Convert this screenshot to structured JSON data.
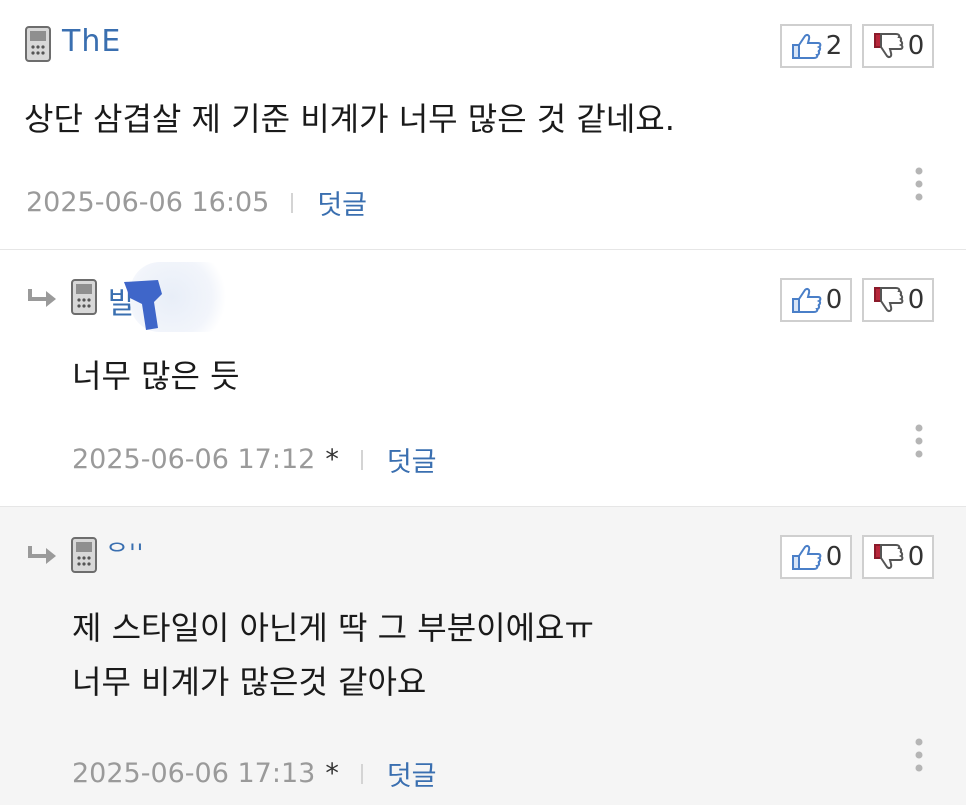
{
  "comments": [
    {
      "nickname": "ThE",
      "likes": "2",
      "dislikes": "0",
      "lines": [
        "상단 삼겹살 제 기준 비계가 너무 많은 것 같네요."
      ],
      "timestamp": "2025-06-06 16:05",
      "reply_label": "덧글",
      "icons": [
        "phone-icon",
        "thumbs-up-icon",
        "thumbs-down-icon",
        "more-vertical-icon"
      ]
    },
    {
      "nickname": "뱔",
      "likes": "0",
      "dislikes": "0",
      "lines": [
        "너무 많은 듯"
      ],
      "timestamp": "2025-06-06 17:12",
      "edited_mark": "*",
      "reply_label": "덧글",
      "icons": [
        "reply-arrow-icon",
        "phone-icon",
        "thumbs-up-icon",
        "thumbs-down-icon",
        "more-vertical-icon"
      ]
    },
    {
      "nickname": "ᄋ''",
      "likes": "0",
      "dislikes": "0",
      "lines": [
        "제 스타일이 아닌게 딱 그 부분이에요ㅠ",
        "너무 비계가 많은것 같아요"
      ],
      "timestamp": "2025-06-06 17:13",
      "edited_mark": "*",
      "reply_label": "덧글",
      "icons": [
        "reply-arrow-icon",
        "phone-icon",
        "thumbs-up-icon",
        "thumbs-down-icon",
        "more-vertical-icon"
      ]
    }
  ],
  "colors": {
    "link": "#3a6fb0",
    "meta": "#9a9a9a",
    "text": "#1a1a1a",
    "reply_bg": "#f5f5f5",
    "thumb_up": "#4a7fc8",
    "thumb_down": "#b8263a"
  }
}
